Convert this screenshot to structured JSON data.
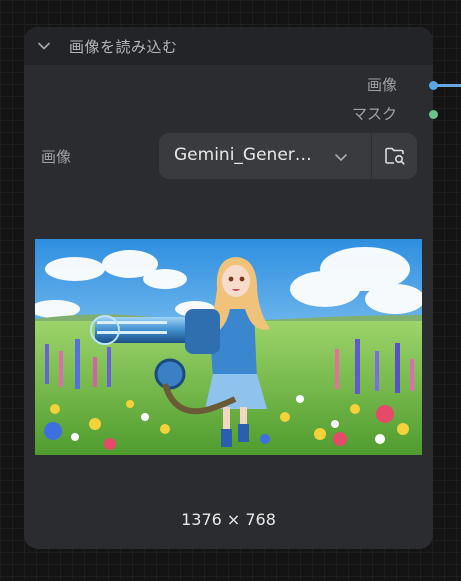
{
  "node": {
    "title": "画像を読み込む",
    "outputs": [
      {
        "label": "画像",
        "color": "#5aa5e6"
      },
      {
        "label": "マスク",
        "color": "#6cc18a"
      }
    ],
    "image_widget": {
      "label": "画像",
      "value": "Gemini_Generated_Image",
      "display_value": "Gemini_Gener…"
    },
    "preview": {
      "alt": "anime girl with minigun in flower field",
      "dimensions": "1376 × 768"
    }
  },
  "colors": {
    "node_bg": "#2b2c2f",
    "header_bg": "#232427",
    "image_wire": "#67a6e4"
  },
  "icons": {
    "collapse": "chevron-down-icon",
    "dropdown": "chevron-down-icon",
    "browse": "folder-search-icon"
  }
}
